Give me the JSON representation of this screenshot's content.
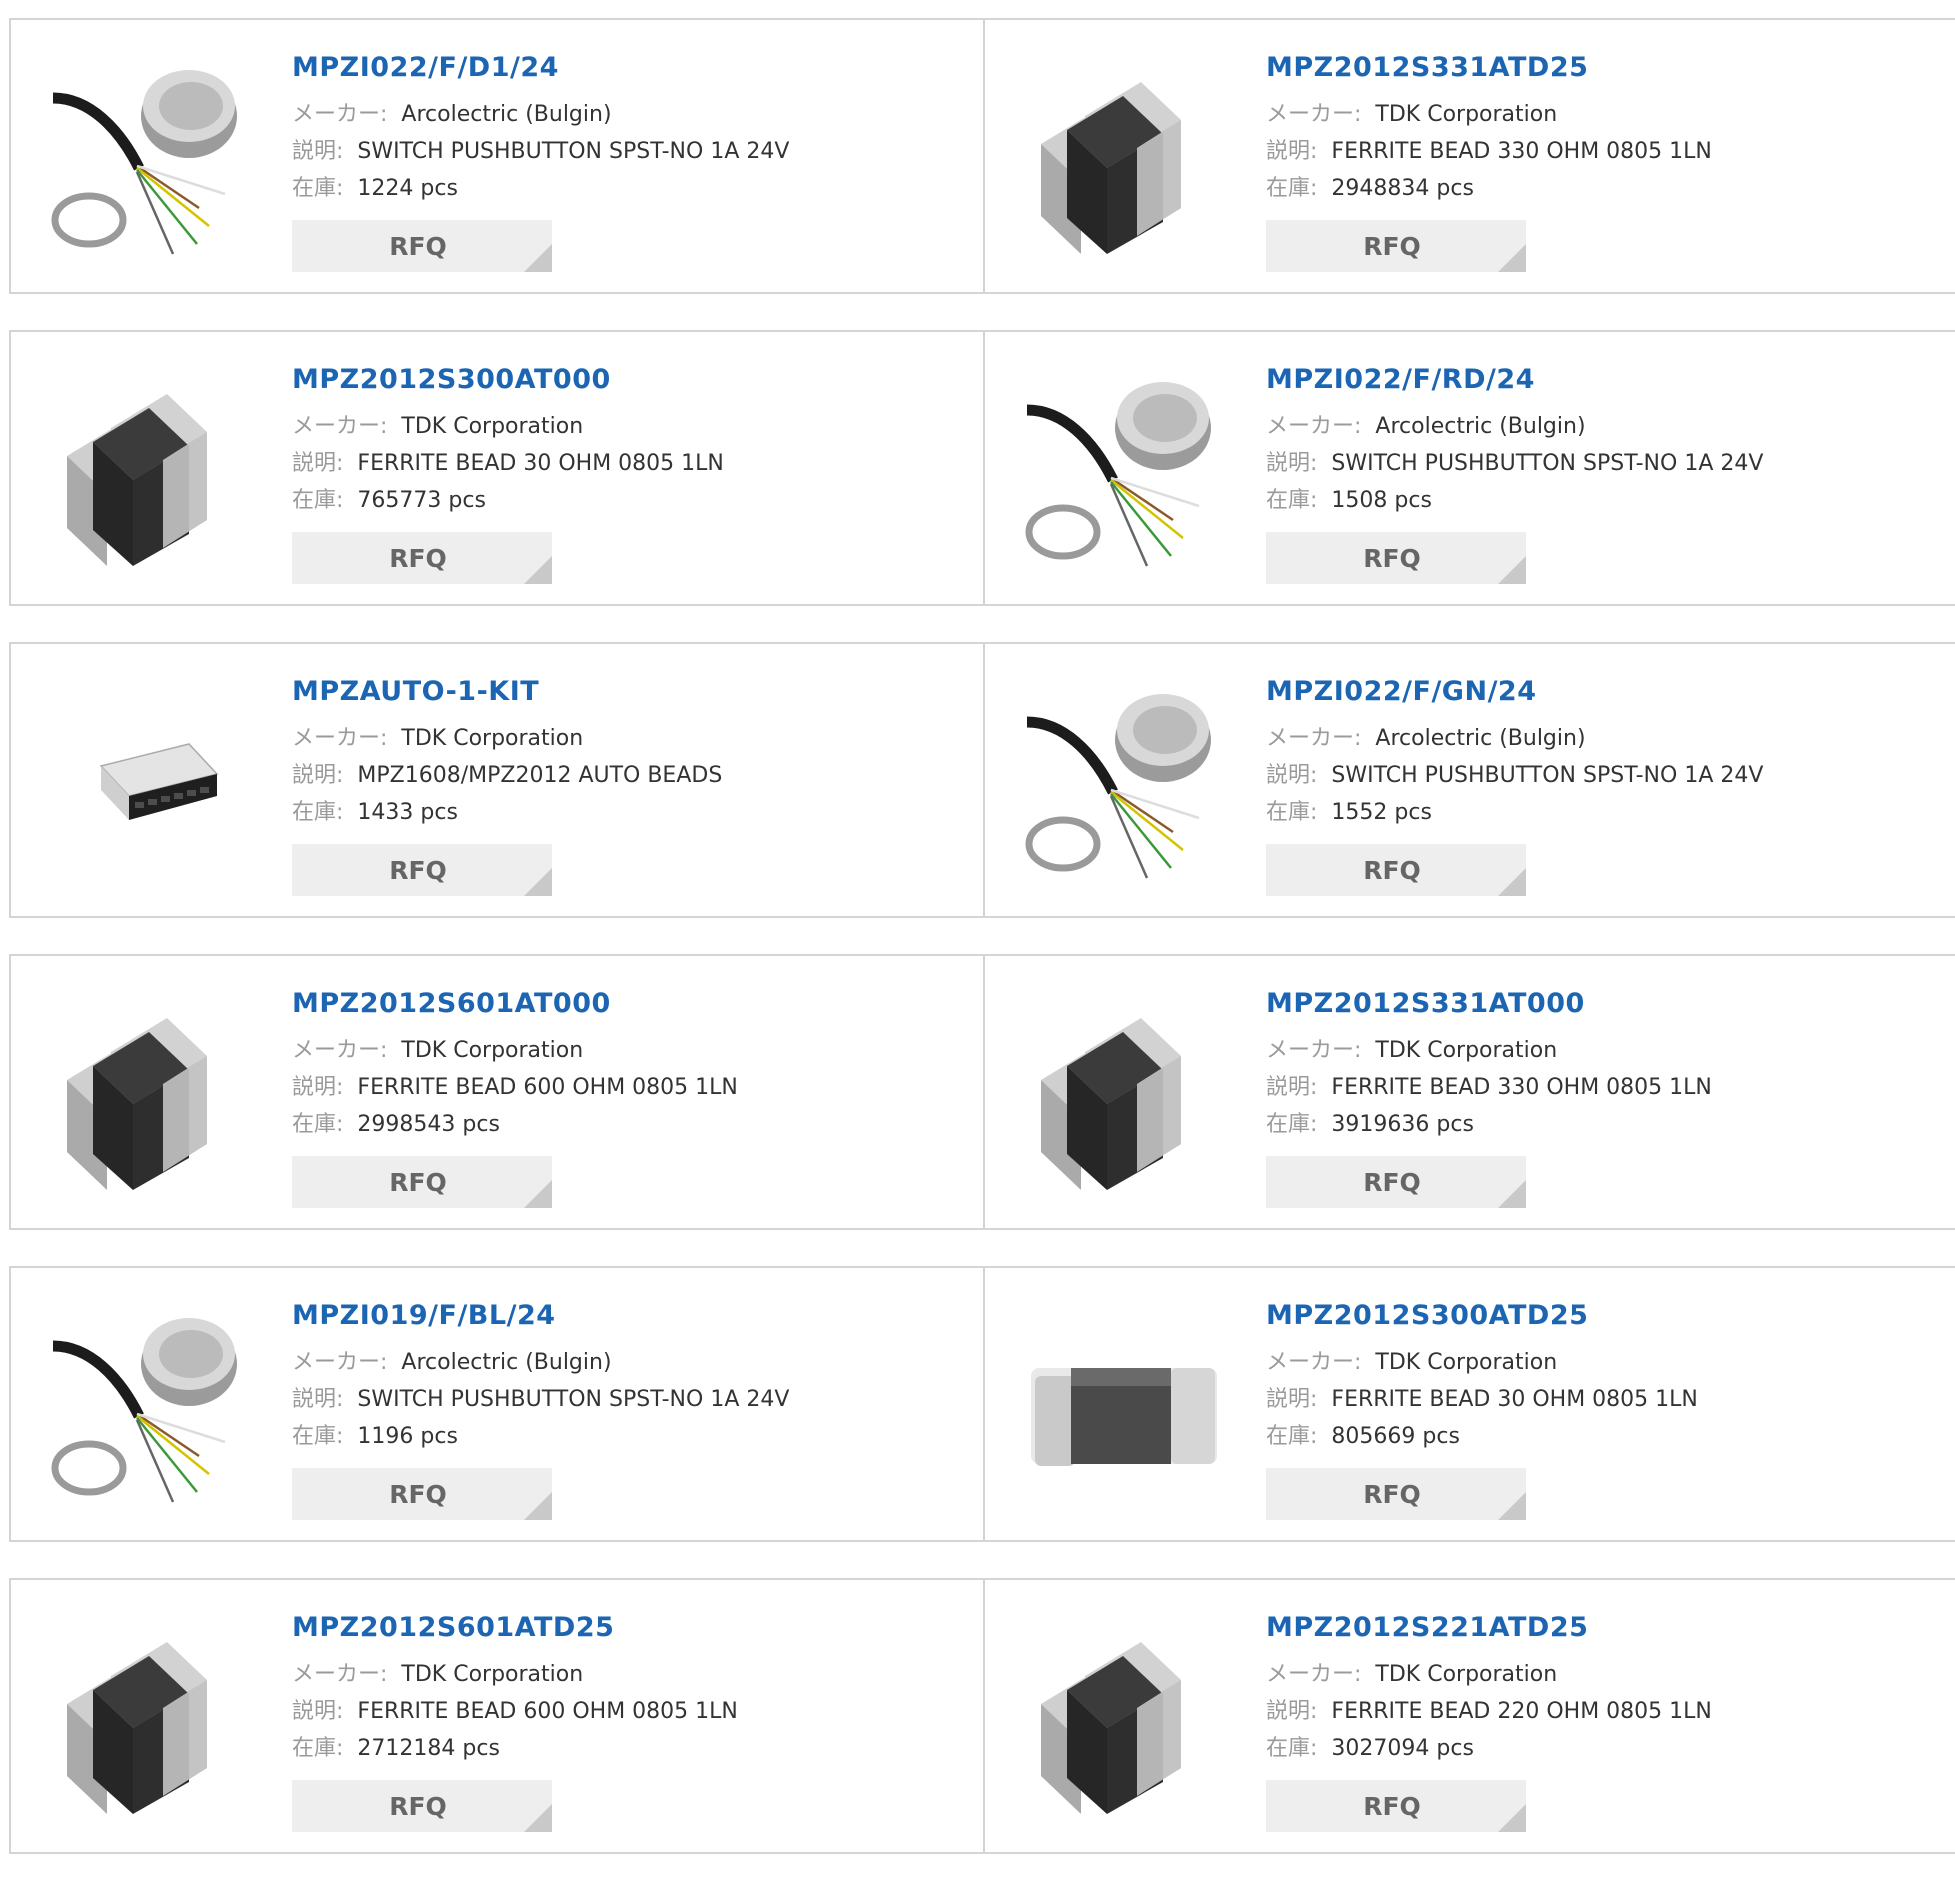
{
  "labels": {
    "maker": "メーカー:",
    "description": "説明:",
    "stock": "在庫:"
  },
  "colors": {
    "part_number_link": "#1b65b3",
    "rfq_bg": "#eeeeee",
    "border": "#d4d4d4"
  },
  "products": [
    {
      "part_number": "MPZI022/F/D1/24",
      "maker": "Arcolectric (Bulgin)",
      "description": "SWITCH PUSHBUTTON SPST-NO 1A 24V",
      "stock": "1224 pcs",
      "rfq": "RFQ",
      "image": "pushbutton-switch-image"
    },
    {
      "part_number": "MPZ2012S331ATD25",
      "maker": "TDK Corporation",
      "description": "FERRITE BEAD 330 OHM 0805 1LN",
      "stock": "2948834 pcs",
      "rfq": "RFQ",
      "image": "ferrite-bead-image"
    },
    {
      "part_number": "MPZ2012S300AT000",
      "maker": "TDK Corporation",
      "description": "FERRITE BEAD 30 OHM 0805 1LN",
      "stock": "765773 pcs",
      "rfq": "RFQ",
      "image": "ferrite-bead-image"
    },
    {
      "part_number": "MPZI022/F/RD/24",
      "maker": "Arcolectric (Bulgin)",
      "description": "SWITCH PUSHBUTTON SPST-NO 1A 24V",
      "stock": "1508 pcs",
      "rfq": "RFQ",
      "image": "pushbutton-switch-image"
    },
    {
      "part_number": "MPZAUTO-1-KIT",
      "maker": "TDK Corporation",
      "description": "MPZ1608/MPZ2012 AUTO BEADS",
      "stock": "1433 pcs",
      "rfq": "RFQ",
      "image": "component-kit-image"
    },
    {
      "part_number": "MPZI022/F/GN/24",
      "maker": "Arcolectric (Bulgin)",
      "description": "SWITCH PUSHBUTTON SPST-NO 1A 24V",
      "stock": "1552 pcs",
      "rfq": "RFQ",
      "image": "pushbutton-switch-image"
    },
    {
      "part_number": "MPZ2012S601AT000",
      "maker": "TDK Corporation",
      "description": "FERRITE BEAD 600 OHM 0805 1LN",
      "stock": "2998543 pcs",
      "rfq": "RFQ",
      "image": "ferrite-bead-image"
    },
    {
      "part_number": "MPZ2012S331AT000",
      "maker": "TDK Corporation",
      "description": "FERRITE BEAD 330 OHM 0805 1LN",
      "stock": "3919636 pcs",
      "rfq": "RFQ",
      "image": "ferrite-bead-image"
    },
    {
      "part_number": "MPZI019/F/BL/24",
      "maker": "Arcolectric (Bulgin)",
      "description": "SWITCH PUSHBUTTON SPST-NO 1A 24V",
      "stock": "1196 pcs",
      "rfq": "RFQ",
      "image": "pushbutton-switch-image"
    },
    {
      "part_number": "MPZ2012S300ATD25",
      "maker": "TDK Corporation",
      "description": "FERRITE BEAD 30 OHM 0805 1LN",
      "stock": "805669 pcs",
      "rfq": "RFQ",
      "image": "flat-ferrite-bead-image"
    },
    {
      "part_number": "MPZ2012S601ATD25",
      "maker": "TDK Corporation",
      "description": "FERRITE BEAD 600 OHM 0805 1LN",
      "stock": "2712184 pcs",
      "rfq": "RFQ",
      "image": "ferrite-bead-image"
    },
    {
      "part_number": "MPZ2012S221ATD25",
      "maker": "TDK Corporation",
      "description": "FERRITE BEAD 220 OHM 0805 1LN",
      "stock": "3027094 pcs",
      "rfq": "RFQ",
      "image": "ferrite-bead-image"
    }
  ]
}
